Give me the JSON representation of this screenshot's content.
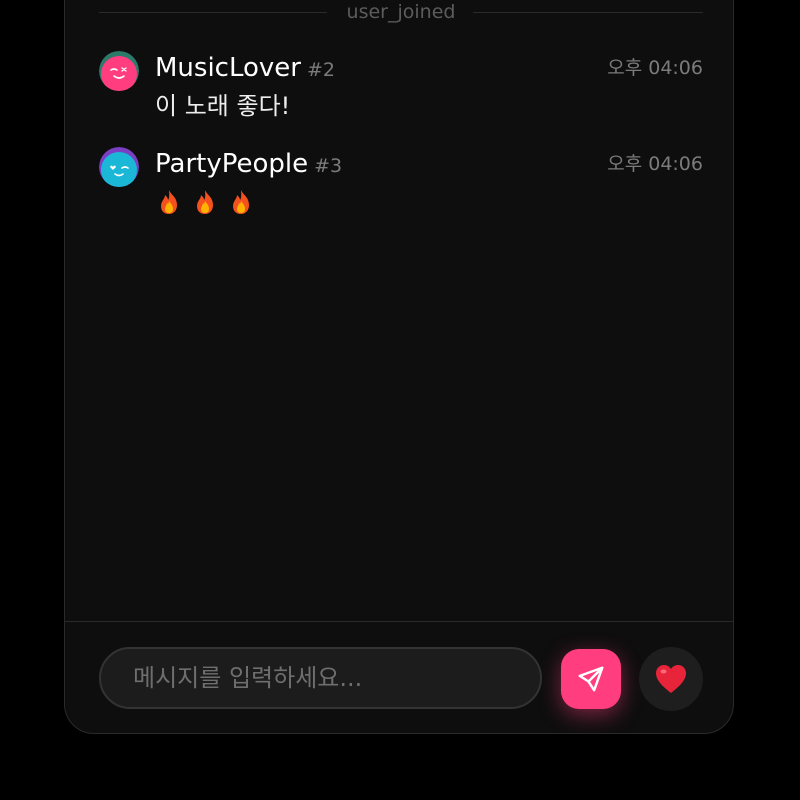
{
  "system_divider": {
    "label": "user_joined"
  },
  "messages": [
    {
      "username": "MusicLover",
      "tag": "#2",
      "time": "오후 04:06",
      "text": "이 노래 좋다!",
      "avatar_icon": "winking-face-avatar-icon",
      "avatar_color": "#ff3d7f"
    },
    {
      "username": "PartyPeople",
      "tag": "#3",
      "time": "오후 04:06",
      "text": "🔥 🔥 🔥",
      "avatar_icon": "heart-eyes-face-avatar-icon",
      "avatar_color": "#1ab8d6"
    }
  ],
  "composer": {
    "placeholder": "메시지를 입력하세요...",
    "send_icon": "send-icon",
    "reaction_icon": "heart-icon"
  },
  "colors": {
    "accent": "#ff3d7f",
    "background": "#0e0e0e",
    "page": "#000000"
  }
}
